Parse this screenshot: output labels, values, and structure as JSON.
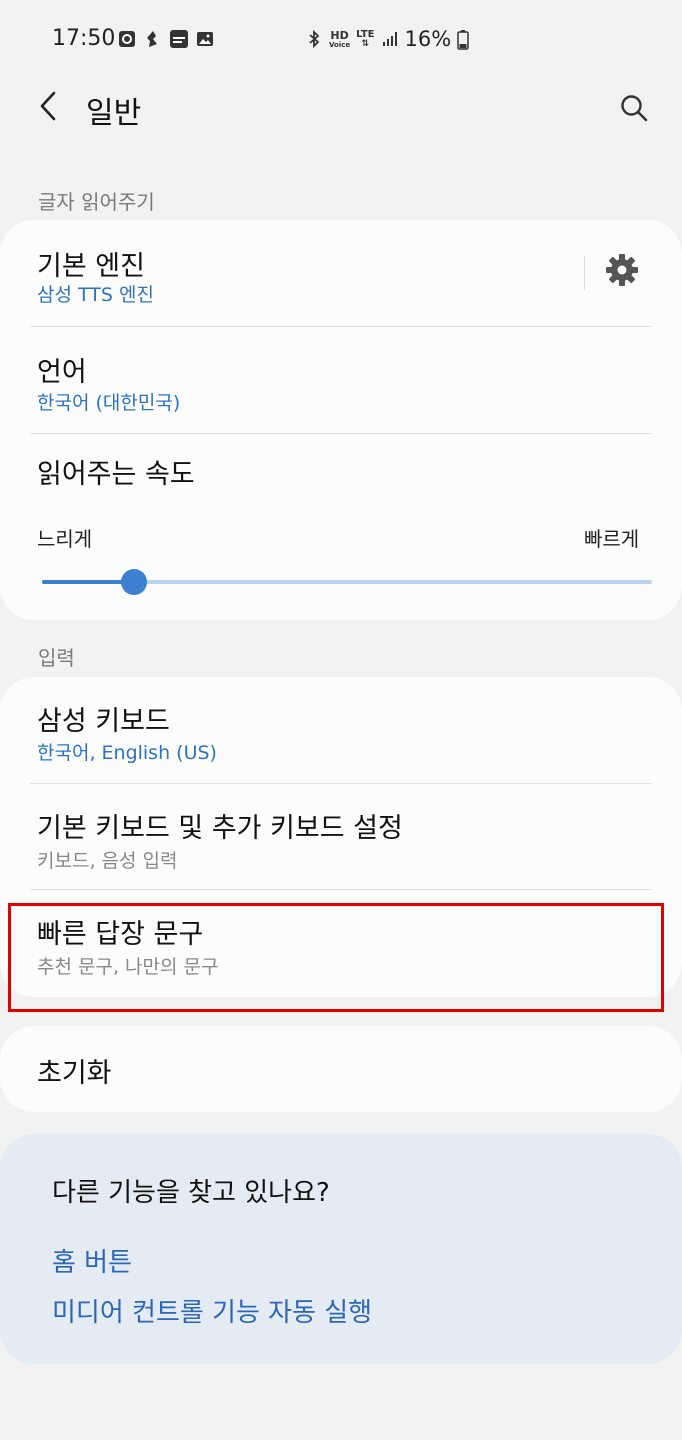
{
  "status_bar": {
    "time": "17:50",
    "left_icons": [
      "screen-record-icon",
      "app-notification-icon",
      "mstock-icon",
      "gallery-icon"
    ],
    "network_hd": "HD",
    "network_voice": "Voice",
    "network_lte": "LTE",
    "battery_percent": "16%"
  },
  "app_bar": {
    "title": "일반"
  },
  "sections": {
    "tts": {
      "header": "글자 읽어주기",
      "engine_title": "기본 엔진",
      "engine_value": "삼성 TTS 엔진",
      "language_title": "언어",
      "language_value": "한국어 (대한민국)",
      "speed_title": "읽어주는 속도",
      "speed_slow": "느리게",
      "speed_fast": "빠르게",
      "speed_level": 0.15
    },
    "input": {
      "header": "입력",
      "samsung_keyboard_title": "삼성 키보드",
      "samsung_keyboard_value": "한국어, English (US)",
      "default_keyboard_title": "기본 키보드 및 추가 키보드 설정",
      "default_keyboard_value": "키보드, 음성 입력",
      "quick_reply_title": "빠른 답장 문구",
      "quick_reply_value": "추천 문구, 나만의 문구"
    },
    "reset": {
      "title": "초기화"
    }
  },
  "suggestions": {
    "title": "다른 기능을 찾고 있나요?",
    "links": [
      "홈 버튼",
      "미디어 컨트롤 기능 자동 실행"
    ]
  },
  "colors": {
    "accent": "#3d7fd1",
    "link": "#2b67b8",
    "highlight": "#e00000",
    "background": "#f2f2f2"
  }
}
